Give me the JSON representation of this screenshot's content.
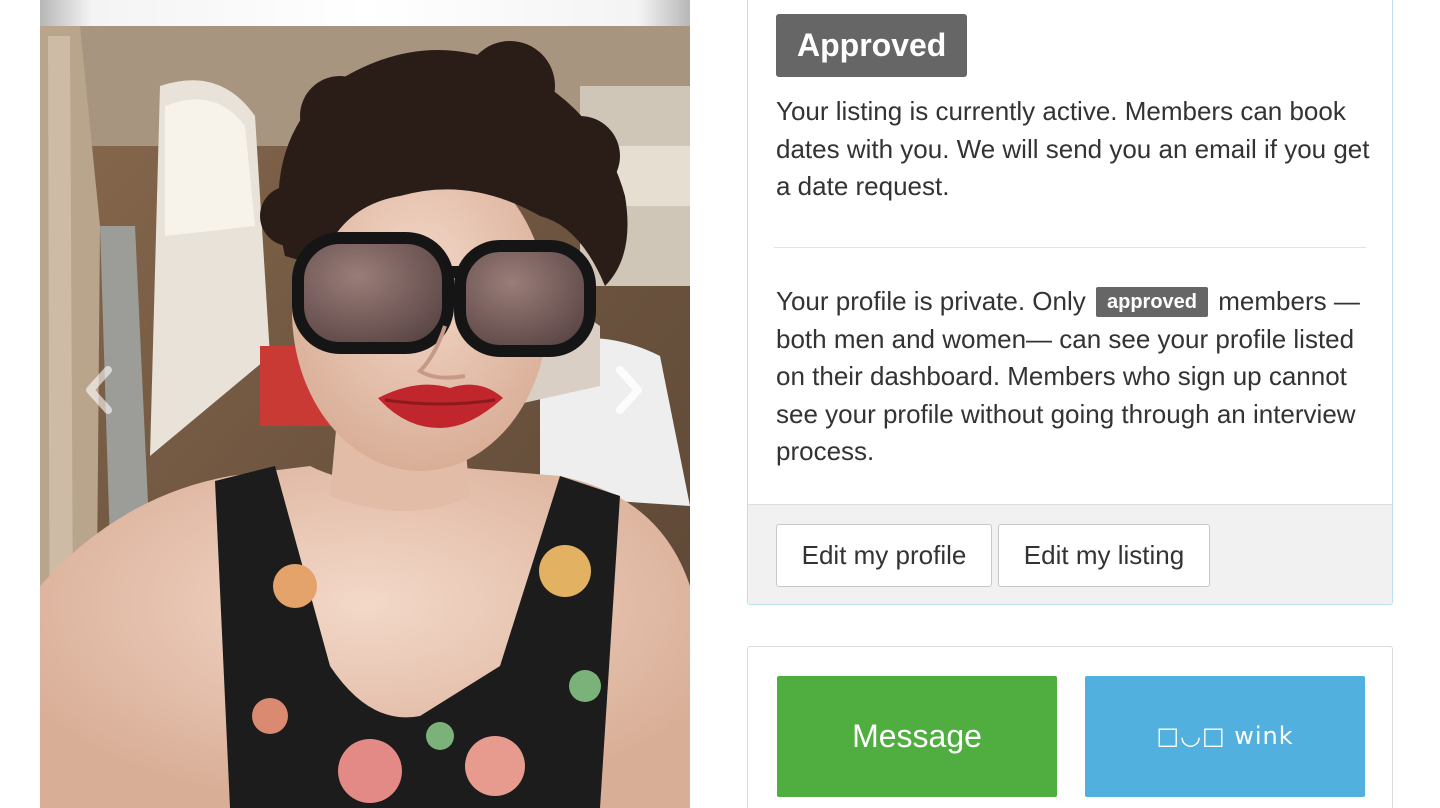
{
  "carousel": {
    "prev_icon": "chevron-left-icon",
    "next_icon": "chevron-right-icon"
  },
  "status": {
    "badge": "Approved",
    "active_text": "Your listing is currently active. Members can book dates with you. We will send you an email if you get a date request.",
    "private_text_before": "Your profile is private. Only",
    "private_badge": "approved",
    "private_text_after": "members — both men and women— can see your profile listed on their dashboard. Members who sign up cannot see your profile without going through an interview process.",
    "edit_profile_label": "Edit my profile",
    "edit_listing_label": "Edit my listing"
  },
  "actions": {
    "message_label": "Message",
    "wink_label": "□◡□ wink"
  },
  "colors": {
    "badge_gray": "#666666",
    "message_green": "#4fae3f",
    "wink_blue": "#52b0df",
    "panel_border_blue": "#bfe0f0"
  }
}
